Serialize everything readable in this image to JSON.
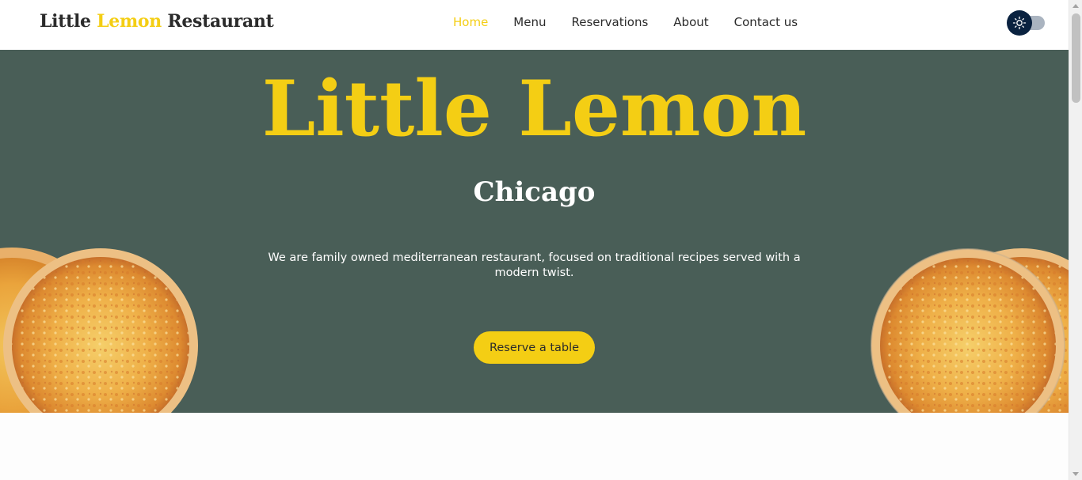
{
  "header": {
    "logo": {
      "part1": "Little",
      "part2": "Lemon",
      "part3": "Restaurant"
    },
    "nav": [
      {
        "label": "Home",
        "active": true
      },
      {
        "label": "Menu",
        "active": false
      },
      {
        "label": "Reservations",
        "active": false
      },
      {
        "label": "About",
        "active": false
      },
      {
        "label": "Contact us",
        "active": false
      }
    ],
    "theme_toggle": {
      "icon": "sun-icon",
      "mode": "light"
    }
  },
  "hero": {
    "title": "Little Lemon",
    "subtitle": "Chicago",
    "description": "We are family owned mediterranean restaurant, focused on traditional recipes served with a modern twist.",
    "cta_label": "Reserve a table",
    "images": [
      "pizza-image",
      "pizza-image",
      "pizza-image",
      "pizza-image"
    ]
  },
  "colors": {
    "primary_green": "#495e57",
    "primary_yellow": "#f4ce14",
    "text_dark": "#2b2b2b",
    "toggle_knob": "#0a2240"
  }
}
